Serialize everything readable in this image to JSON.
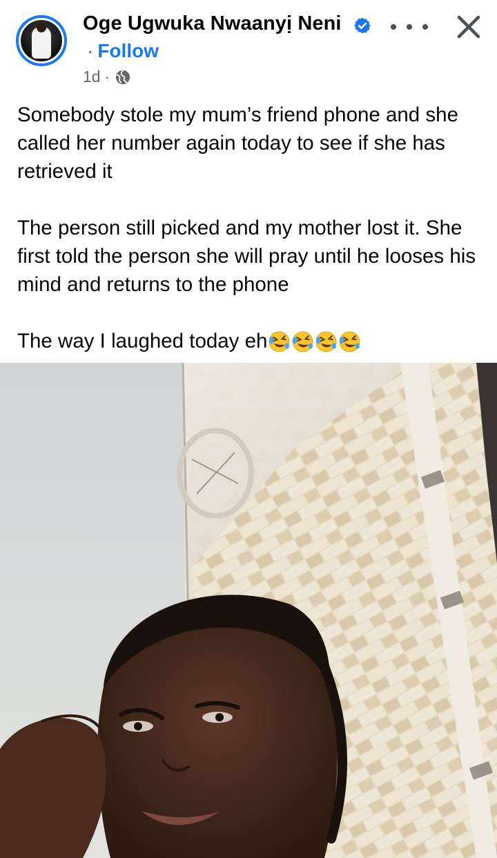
{
  "post": {
    "author": {
      "name": "Oge Ugwuka Nwaanyị Neni",
      "verified": true,
      "avatar_icon": "profile-photo"
    },
    "follow_separator": "·",
    "follow_label": "Follow",
    "time": "1d",
    "meta_separator": "·",
    "audience_icon": "globe-icon",
    "more_icon": "more-options-icon",
    "close_icon": "close-icon",
    "paragraphs": [
      "Somebody stole my mum’s friend phone and she called her number again today to see if she has retrieved it",
      "The person still picked and my mother lost it. She first told the person she will pray until he looses his mind and returns to the phone",
      "The way I laughed today eh"
    ],
    "trailing_emoji": [
      "rolling-on-floor-laughing",
      "rolling-on-floor-laughing",
      "rolling-on-floor-laughing",
      "rolling-on-floor-laughing"
    ],
    "media_type": "video-still"
  },
  "colors": {
    "accent": "#1877f2",
    "text": "#050505",
    "secondary_text": "#65676b"
  }
}
